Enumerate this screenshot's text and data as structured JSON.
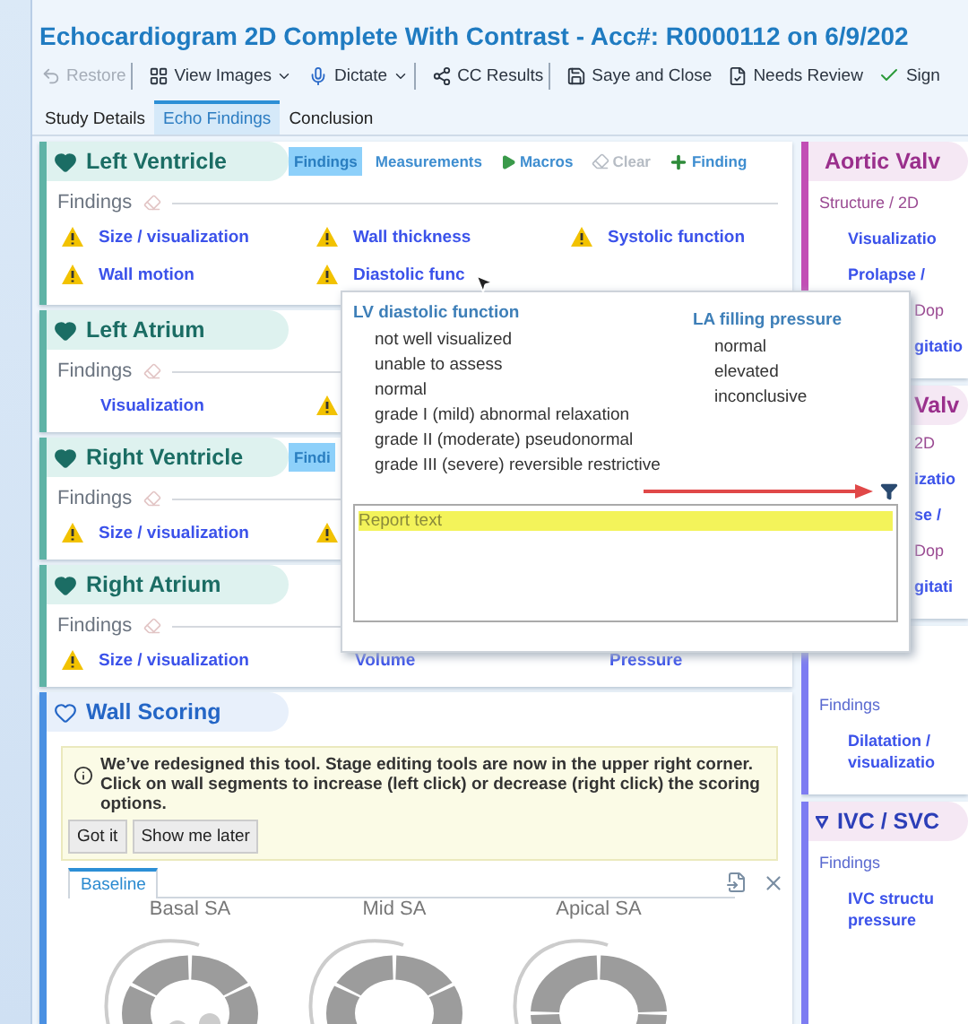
{
  "window": {
    "title": "Echocardiogram 2D Complete With Contrast - Acc#: R0000112 on 6/9/202"
  },
  "toolbar": [
    {
      "label": "Restore",
      "kind": "restore",
      "disabled": true,
      "caret": false,
      "separator_after": true
    },
    {
      "label": "View Images",
      "kind": "images",
      "disabled": false,
      "caret": true,
      "separator_after": false
    },
    {
      "label": "Dictate",
      "kind": "mic",
      "disabled": false,
      "caret": true,
      "separator_after": true
    },
    {
      "label": "CC Results",
      "kind": "share",
      "disabled": false,
      "caret": false,
      "separator_after": true
    },
    {
      "label": "Saye and Close",
      "kind": "save",
      "disabled": false,
      "caret": false,
      "separator_after": false
    },
    {
      "label": "Needs Review",
      "kind": "review",
      "disabled": false,
      "caret": false,
      "separator_after": false
    },
    {
      "label": "Sign",
      "kind": "sign",
      "disabled": false,
      "caret": false,
      "separator_after": false
    }
  ],
  "tabs": [
    {
      "label": "Study Details",
      "selected": false
    },
    {
      "label": "Echo Findings",
      "selected": true
    },
    {
      "label": "Conclusion",
      "selected": false
    }
  ],
  "left_panels": [
    {
      "title": "Left Ventricle",
      "tools": [
        {
          "label": "Findings",
          "kind": "tab",
          "selected": true,
          "disabled": false
        },
        {
          "label": "Measurements",
          "kind": "tab",
          "selected": false,
          "disabled": false
        },
        {
          "label": "Macros",
          "kind": "play",
          "selected": false,
          "disabled": false
        },
        {
          "label": "Clear",
          "kind": "eraser",
          "selected": false,
          "disabled": true
        },
        {
          "label": "Finding",
          "kind": "add",
          "selected": false,
          "disabled": false
        }
      ],
      "findings_label": "Findings",
      "items": [
        {
          "label": "Size / visualization",
          "warning": true
        },
        {
          "label": "Wall thickness",
          "warning": true
        },
        {
          "label": "Systolic function",
          "warning": true
        },
        {
          "label": "Wall motion",
          "warning": true
        },
        {
          "label": "Diastolic func",
          "warning": true
        }
      ]
    },
    {
      "title": "Left Atrium",
      "findings_label": "Findings",
      "items": [
        {
          "label": "Visualization",
          "warning": false
        },
        {
          "warning": true
        }
      ]
    },
    {
      "title": "Right Ventricle",
      "tools": [
        {
          "label": "Findi",
          "kind": "tab",
          "selected": true,
          "disabled": false
        }
      ],
      "findings_label": "Findings",
      "items": [
        {
          "label": "Size / visualization",
          "warning": true
        },
        {
          "warning": true
        }
      ]
    },
    {
      "title": "Right Atrium",
      "findings_label": "Findings",
      "items": [
        {
          "label": "Size / visualization",
          "warning": true
        },
        {
          "label": "Volume",
          "warning": false
        },
        {
          "label": "Pressure",
          "warning": false
        }
      ]
    }
  ],
  "wall_scoring": {
    "title": "Wall Scoring",
    "notice": "We’ve redesigned this tool. Stage editing tools are now in the upper right corner. Click on wall segments to increase (left click) or decrease (right click) the scoring options.",
    "buttons": [
      "Got it",
      "Show me later"
    ],
    "tabs": [
      {
        "label": "Baseline",
        "selected": true
      }
    ],
    "views": [
      {
        "label": "Basal SA",
        "kind": "basal"
      },
      {
        "label": "Mid SA",
        "kind": "mid"
      },
      {
        "label": "Apical SA",
        "kind": "apical"
      }
    ]
  },
  "popup": {
    "groups": [
      {
        "title": "LV diastolic function",
        "options": [
          "not well visualized",
          "unable to assess",
          "normal",
          "grade I (mild) abnormal relaxation",
          "grade II (moderate) pseudonormal",
          "grade III (severe) reversible restrictive"
        ]
      },
      {
        "title": "LA filling pressure",
        "options": [
          "normal",
          "elevated",
          "inconclusive"
        ]
      }
    ],
    "report": {
      "placeholder": "Report text"
    }
  },
  "right_panels": [
    {
      "title": "Aortic Valv",
      "color": "#c24fb5",
      "rows": [
        {
          "text": "Structure / 2D",
          "kind": "section"
        },
        {
          "text": "Visualizatio",
          "kind": "link"
        },
        {
          "text": "Prolapse /",
          "kind": "link"
        },
        {
          "text": "Dop",
          "kind": "section-clipped"
        },
        {
          "text": "gitatio",
          "kind": "link-clipped"
        }
      ]
    },
    {
      "title": "Valv",
      "title_clipped": true,
      "rows": [
        {
          "text": "2D",
          "kind": "section-clipped"
        },
        {
          "text": "izatio",
          "kind": "link-clipped"
        },
        {
          "text": "se /",
          "kind": "link-clipped"
        },
        {
          "text": "Dop",
          "kind": "section-clipped"
        },
        {
          "text": "gitati",
          "kind": "link-clipped"
        }
      ]
    },
    {
      "color": "#7d7cf2",
      "rows": [
        {
          "text": "Findings",
          "kind": "label"
        },
        {
          "text": "Dilatation / visualizatio",
          "kind": "link"
        }
      ]
    },
    {
      "title": "IVC / SVC",
      "color": "#7d7cf2",
      "rows": [
        {
          "text": "Findings",
          "kind": "label"
        },
        {
          "text": "IVC structu pressure",
          "kind": "link"
        }
      ]
    }
  ]
}
